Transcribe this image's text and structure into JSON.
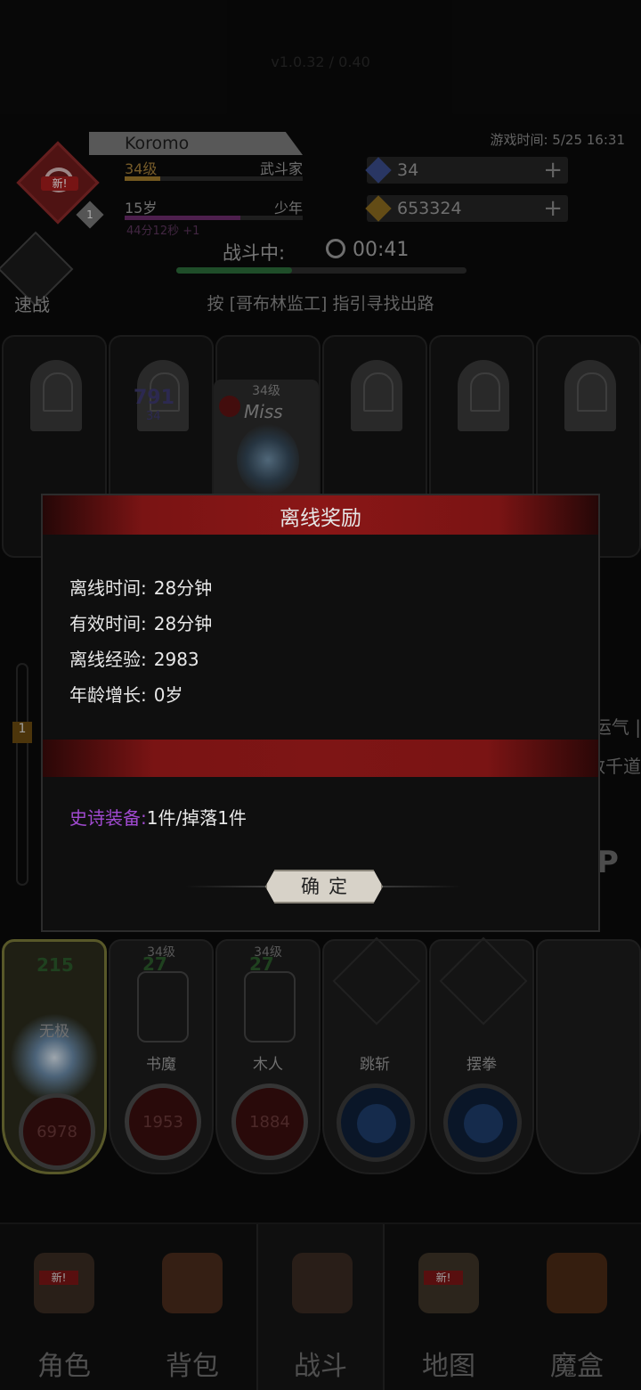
{
  "header": {
    "version": "v1.0.32 / 0.40",
    "avatar_tag": "新!",
    "avatar_level": "1",
    "player_name": "Koromo",
    "level": "34级",
    "class": "武斗家",
    "age": "15岁",
    "age_stage": "少年",
    "age_timer": "44分12秒 +1",
    "game_time": "游戏时间: 5/25 16:31",
    "gems": "34",
    "gold": "653324",
    "plus": "+"
  },
  "battle": {
    "status_label": "战斗中:",
    "timer": "00:41",
    "progress": 0.4,
    "quick_battle": "速战",
    "guide": "按 [哥布林监工] 指引寻找出路"
  },
  "enemy_slots": {
    "damage": "791",
    "damage_sub": "34",
    "active_level": "34级",
    "miss": "Miss"
  },
  "side": {
    "gauge_mark": "1",
    "right_text1": "运气 |",
    "right_text2": "数千道"
  },
  "modal": {
    "title": "离线奖励",
    "rows": [
      {
        "key": "离线时间:",
        "value": "28分钟"
      },
      {
        "key": "有效时间:",
        "value": "28分钟"
      },
      {
        "key": "离线经验:",
        "value": "2983"
      },
      {
        "key": "年龄增长:",
        "value": "0岁"
      }
    ],
    "epic_key": "史诗装备:",
    "epic_value": "1件/掉落1件",
    "confirm": "确定"
  },
  "skills": [
    {
      "level": "",
      "name": "无极",
      "top_num": "215",
      "value": "6978"
    },
    {
      "level": "34级",
      "name": "书魔",
      "top_num": "27",
      "value": "1953"
    },
    {
      "level": "34级",
      "name": "木人",
      "top_num": "27",
      "value": "1884"
    },
    {
      "level": "",
      "name": "跳斩",
      "top_num": "",
      "value": ""
    },
    {
      "level": "",
      "name": "摆拳",
      "top_num": "",
      "value": ""
    }
  ],
  "nav": [
    {
      "label": "角色",
      "tag": "新!",
      "icon": "helmet-icon"
    },
    {
      "label": "背包",
      "tag": "",
      "icon": "backpack-icon"
    },
    {
      "label": "战斗",
      "tag": "",
      "icon": "sword-shield-icon"
    },
    {
      "label": "地图",
      "tag": "新!",
      "icon": "scroll-map-icon"
    },
    {
      "label": "魔盒",
      "tag": "",
      "icon": "magic-box-icon"
    }
  ]
}
